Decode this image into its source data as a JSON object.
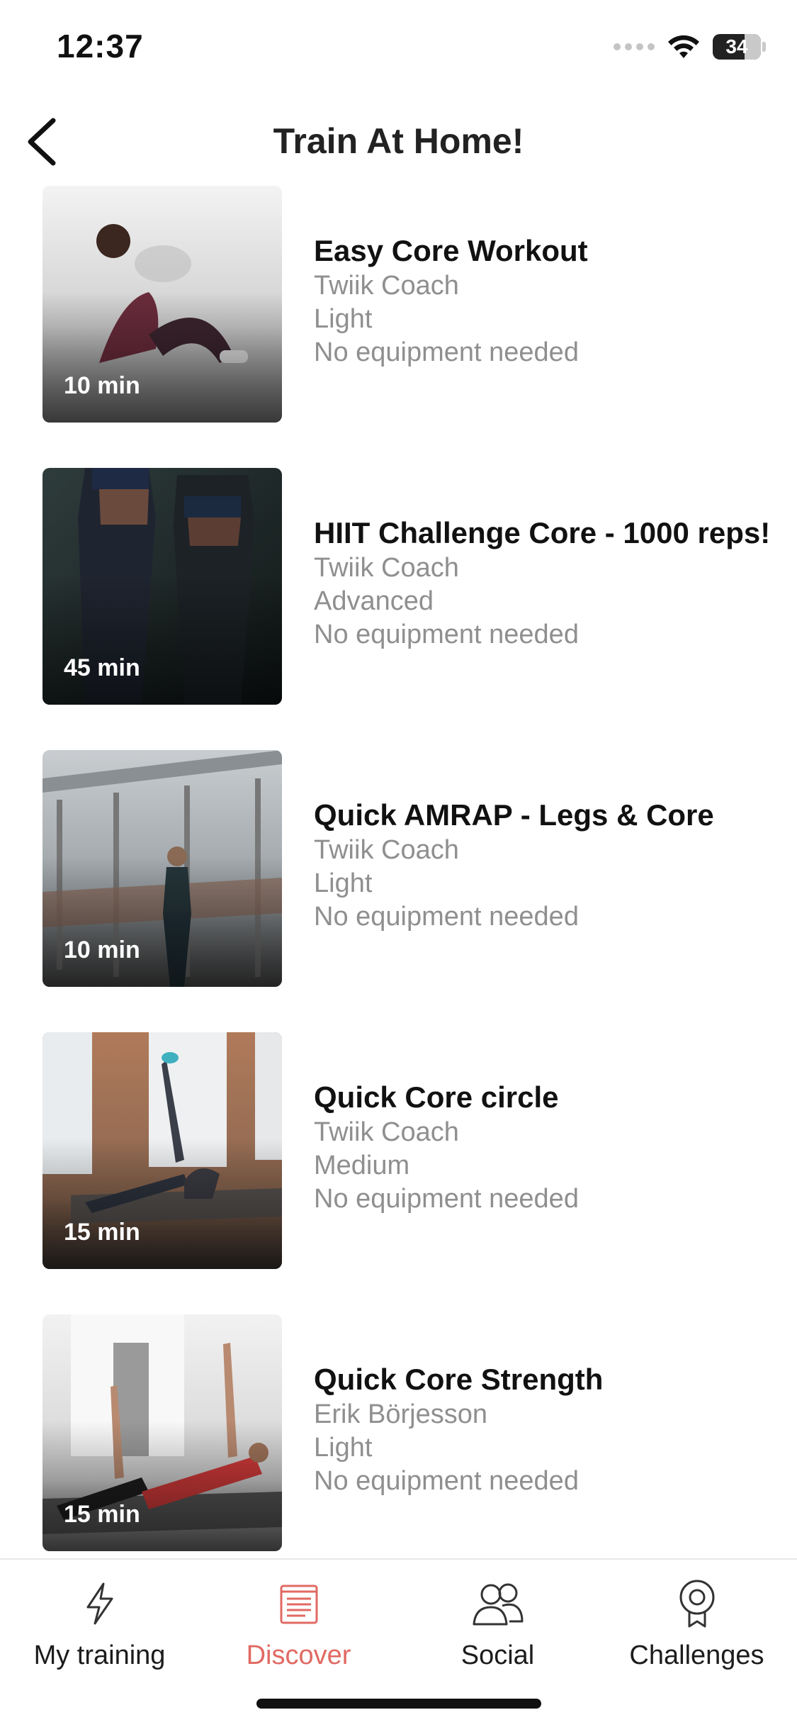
{
  "status_bar": {
    "time": "12:37",
    "battery_level": "34",
    "battery_fraction": 0.34
  },
  "header": {
    "title": "Train At Home!",
    "back_icon": "chevron-left-icon"
  },
  "workouts": [
    {
      "title": "Easy Core Workout",
      "coach": "Twiik Coach",
      "level": "Light",
      "equipment": "No equipment needed",
      "duration": "10 min"
    },
    {
      "title": "HIIT Challenge Core - 1000 reps!",
      "coach": "Twiik Coach",
      "level": "Advanced",
      "equipment": "No equipment needed",
      "duration": "45 min"
    },
    {
      "title": "Quick AMRAP - Legs & Core",
      "coach": "Twiik Coach",
      "level": "Light",
      "equipment": "No equipment needed",
      "duration": "10 min"
    },
    {
      "title": "Quick Core circle",
      "coach": "Twiik Coach",
      "level": "Medium",
      "equipment": "No equipment needed",
      "duration": "15 min"
    },
    {
      "title": "Quick Core Strength",
      "coach": "Erik Börjesson",
      "level": "Light",
      "equipment": "No equipment needed",
      "duration": "15 min"
    }
  ],
  "tab_bar": {
    "tabs": [
      {
        "label": "My training",
        "icon": "lightning-bolt-icon",
        "active": false
      },
      {
        "label": "Discover",
        "icon": "document-icon",
        "active": true
      },
      {
        "label": "Social",
        "icon": "people-icon",
        "active": false
      },
      {
        "label": "Challenges",
        "icon": "medal-icon",
        "active": false
      }
    ]
  },
  "colors": {
    "accent": "#e06a63",
    "text_primary": "#111111",
    "text_secondary": "#8f8f8f"
  }
}
